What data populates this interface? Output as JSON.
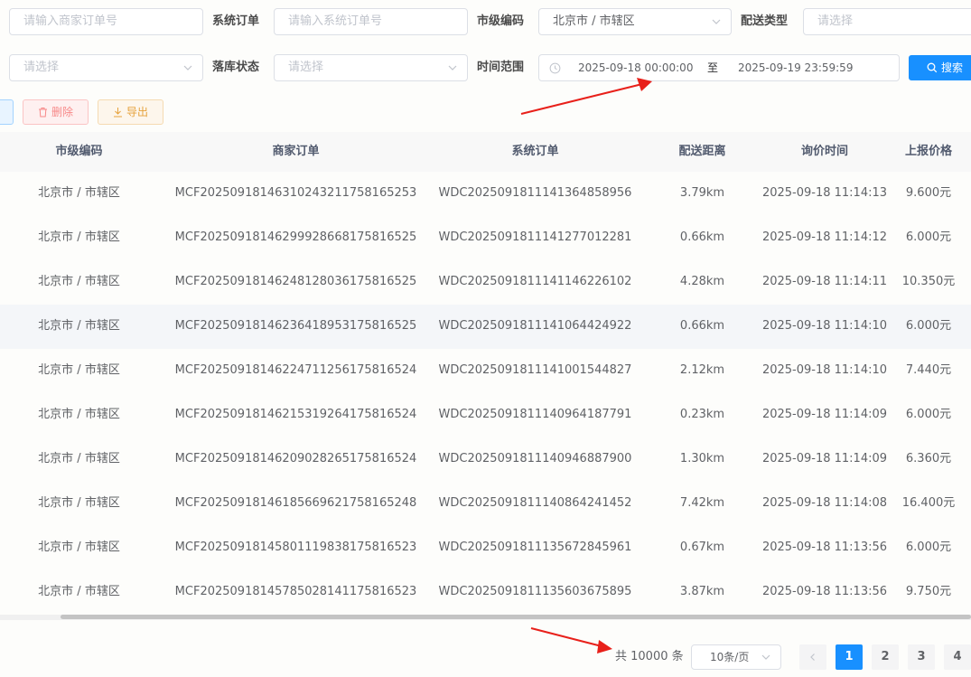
{
  "filters": {
    "merchant_order_placeholder": "请输入商家订单号",
    "system_order_label": "系统订单",
    "system_order_placeholder": "请输入系统订单号",
    "city_code_label": "市级编码",
    "city_code_value": "北京市 / 市辖区",
    "delivery_type_label": "配送类型",
    "delivery_type_placeholder": "请选择",
    "first_select_placeholder": "请选择",
    "stock_status_label": "落库状态",
    "stock_status_placeholder": "请选择",
    "time_range_label": "时间范围",
    "start_time": "2025-09-18 00:00:00",
    "range_separator": "至",
    "end_time": "2025-09-19 23:59:59",
    "search_label": "搜索"
  },
  "toolbar": {
    "delete_label": "删除",
    "export_label": "导出"
  },
  "table": {
    "headers": {
      "city": "市级编码",
      "merchant_order": "商家订单",
      "system_order": "系统订单",
      "distance": "配送距离",
      "inquiry_time": "询价时间",
      "price": "上报价格"
    },
    "rows": [
      {
        "city": "北京市 / 市辖区",
        "merchant_order": "MCF20250918146310243211758165253",
        "system_order": "WDC20250918111413648589​56",
        "distance": "3.79km",
        "inquiry_time": "2025-09-18 11:14:13",
        "price": "9.600元"
      },
      {
        "city": "北京市 / 市辖区",
        "merchant_order": "MCF20250918146299928668175816525",
        "system_order": "WDC202509181114127701228​1",
        "distance": "0.66km",
        "inquiry_time": "2025-09-18 11:14:12",
        "price": "6.000元"
      },
      {
        "city": "北京市 / 市辖区",
        "merchant_order": "MCF20250918146248128036175816525",
        "system_order": "WDC2025091811141146226102",
        "distance": "4.28km",
        "inquiry_time": "2025-09-18 11:14:11",
        "price": "10.350元"
      },
      {
        "city": "北京市 / 市辖区",
        "merchant_order": "MCF20250918146236418953175816525",
        "system_order": "WDC2025091811141064424922",
        "distance": "0.66km",
        "inquiry_time": "2025-09-18 11:14:10",
        "price": "6.000元"
      },
      {
        "city": "北京市 / 市辖区",
        "merchant_order": "MCF20250918146224711256175816524",
        "system_order": "WDC2025091811141001544827",
        "distance": "2.12km",
        "inquiry_time": "2025-09-18 11:14:10",
        "price": "7.440元"
      },
      {
        "city": "北京市 / 市辖区",
        "merchant_order": "MCF20250918146215319264175816524",
        "system_order": "WDC2025091811140964187791",
        "distance": "0.23km",
        "inquiry_time": "2025-09-18 11:14:09",
        "price": "6.000元"
      },
      {
        "city": "北京市 / 市辖区",
        "merchant_order": "MCF20250918146209028265175816524",
        "system_order": "WDC2025091811140946887900",
        "distance": "1.30km",
        "inquiry_time": "2025-09-18 11:14:09",
        "price": "6.360元"
      },
      {
        "city": "北京市 / 市辖区",
        "merchant_order": "MCF20250918146185669621758165248",
        "system_order": "WDC2025091811140864241452",
        "distance": "7.42km",
        "inquiry_time": "2025-09-18 11:14:08",
        "price": "16.400元"
      },
      {
        "city": "北京市 / 市辖区",
        "merchant_order": "MCF20250918145801119838175816523",
        "system_order": "WDC2025091811135672845961",
        "distance": "0.67km",
        "inquiry_time": "2025-09-18 11:13:56",
        "price": "6.000元"
      },
      {
        "city": "北京市 / 市辖区",
        "merchant_order": "MCF20250918145785028141175816523",
        "system_order": "WDC2025091811135603675895",
        "distance": "3.87km",
        "inquiry_time": "2025-09-18 11:13:56",
        "price": "9.750元"
      }
    ]
  },
  "pagination": {
    "total_text": "共 10000 条",
    "page_size": "10条/页",
    "pages": [
      "1",
      "2",
      "3",
      "4"
    ],
    "current_page": "1"
  },
  "colors": {
    "primary": "#1890ff",
    "danger_border": "#fbc4c4",
    "warning_border": "#f5dab1",
    "annotation_arrow": "#e8201a"
  }
}
